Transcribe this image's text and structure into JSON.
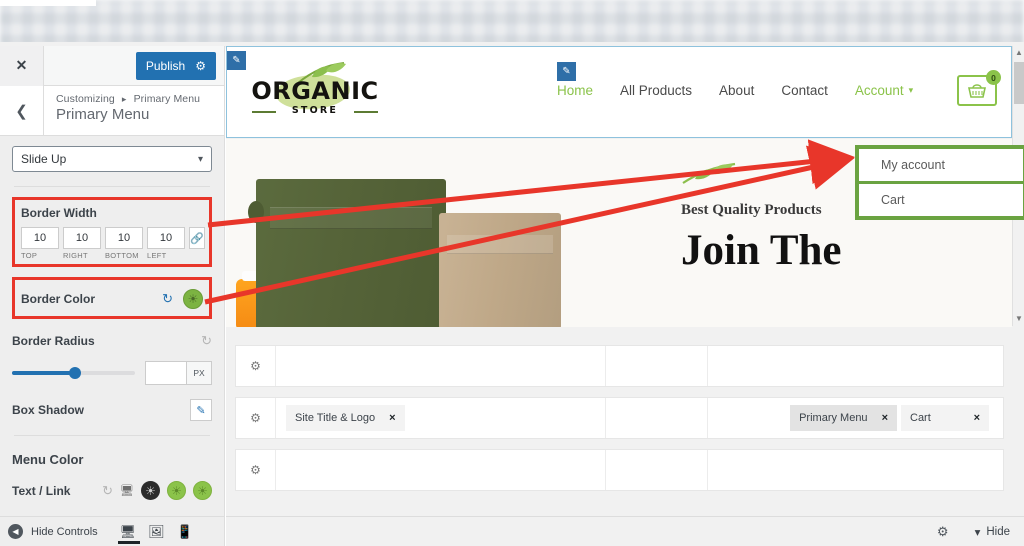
{
  "customizer": {
    "close_icon": "close-icon",
    "publish_label": "Publish",
    "publish_gear_icon": "gear-icon",
    "back_icon": "chevron-left-icon",
    "breadcrumb_root": "Customizing",
    "breadcrumb_sep": "▸",
    "breadcrumb_current": "Primary Menu",
    "panel_title": "Primary Menu",
    "animation_select": {
      "value": "Slide Up",
      "caret": "chevron-down-icon"
    },
    "border_width": {
      "label": "Border Width",
      "fields": [
        {
          "value": "10",
          "side": "TOP"
        },
        {
          "value": "10",
          "side": "RIGHT"
        },
        {
          "value": "10",
          "side": "BOTTOM"
        },
        {
          "value": "10",
          "side": "LEFT"
        }
      ],
      "link_icon": "link-icon"
    },
    "border_color": {
      "label": "Border Color",
      "reset_icon": "reset-icon",
      "swatch_color": "#7cb342",
      "swatch_icon": "globe-icon"
    },
    "border_radius": {
      "label": "Border Radius",
      "reset_icon": "reset-icon",
      "value": "",
      "unit": "PX"
    },
    "box_shadow": {
      "label": "Box Shadow",
      "edit_icon": "pencil-icon"
    },
    "menu_color": {
      "title": "Menu Color",
      "text_link_label": "Text / Link",
      "reset_icon": "reset-icon",
      "responsive_icon": "desktop-icon",
      "swatches": [
        "#2b2b2b",
        "#8bc34a",
        "#8bc34a"
      ]
    },
    "footer": {
      "hide_controls_label": "Hide Controls",
      "hide_icon": "collapse-icon",
      "devices": [
        "desktop-icon",
        "tablet-icon",
        "mobile-icon"
      ],
      "active_device": "desktop-icon"
    }
  },
  "preview": {
    "edit_pencils": [
      "pencil-icon",
      "pencil-icon"
    ],
    "logo": {
      "word": "ORGANIC",
      "sub": "STORE"
    },
    "nav": [
      {
        "label": "Home",
        "active": true
      },
      {
        "label": "All Products",
        "active": false
      },
      {
        "label": "About",
        "active": false
      },
      {
        "label": "Contact",
        "active": false
      },
      {
        "label": "Account",
        "active": false,
        "has_caret": true
      }
    ],
    "cart": {
      "icon": "shopping-basket-icon",
      "count": "0"
    },
    "dropdown": {
      "items": [
        "My account",
        "Cart"
      ]
    },
    "hero": {
      "leaf_icon": "leaf-branch-icon",
      "eyebrow": "Best Quality Products",
      "heading": "Join The"
    },
    "widget_rows": [
      {
        "gear": "gear-icon",
        "left_chips": [],
        "right_chips": []
      },
      {
        "gear": "gear-icon",
        "left_chips": [
          {
            "label": "Site Title & Logo",
            "close": "×",
            "active": false
          }
        ],
        "right_chips": [
          {
            "label": "Primary Menu",
            "close": "×",
            "active": true
          },
          {
            "label": "Cart",
            "close": "×",
            "active": false
          }
        ]
      },
      {
        "gear": "gear-icon",
        "left_chips": [],
        "right_chips": []
      }
    ],
    "footer": {
      "gear_icon": "gear-icon",
      "hide_label": "Hide",
      "hide_caret": "chevron-down-icon"
    }
  },
  "colors": {
    "publish_blue": "#2271b1",
    "annotation_red": "#e8362a",
    "brand_green": "#8bc34a",
    "dropdown_border_green": "#6aa341"
  }
}
